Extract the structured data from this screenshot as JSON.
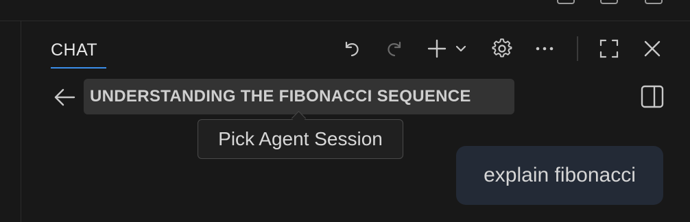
{
  "chat": {
    "tab_label": "CHAT",
    "session_title": "UNDERSTANDING THE FIBONACCI SEQUENCE",
    "tooltip": "Pick Agent Session",
    "messages": [
      {
        "role": "user",
        "text": "explain fibonacci"
      }
    ]
  },
  "toolbar": {
    "icons": [
      "undo-icon",
      "redo-icon",
      "add-icon",
      "chevron-down-icon",
      "gear-icon",
      "more-icon",
      "maximize-icon",
      "close-icon"
    ]
  },
  "colors": {
    "background": "#181818",
    "tab_underline": "#3b8eea",
    "title_chip": "#333333",
    "message_bubble": "#232a36"
  }
}
